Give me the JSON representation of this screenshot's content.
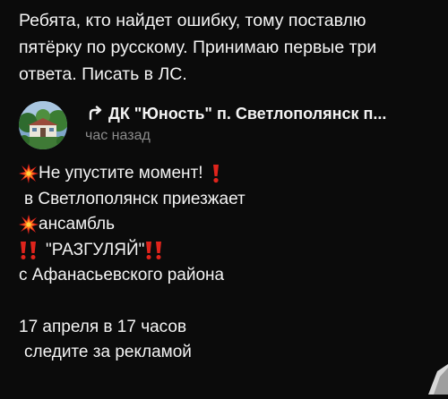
{
  "intro": {
    "lines": [
      "Ребята, кто найдет ошибку, тому поставлю",
      "пятёрку по русскому. Принимаю первые три",
      "ответа. Писать в ЛС."
    ]
  },
  "post": {
    "group_name": "ДК \"Юность\" п. Светлополянск п...",
    "time": "час назад",
    "body": {
      "line1": "Не упустите момент!",
      "line2": "в Светлополянск приезжает",
      "line3": "ансамбль",
      "line4": "\"РАЗГУЛЯЙ\"",
      "line5": "с Афанасьевского района",
      "line6": "17 апреля в 17 часов",
      "line7": "следите за рекламой"
    }
  },
  "icons": {
    "repost": "repost-arrow-icon",
    "spark": "collision-spark-emoji",
    "exclamation": "red-exclamation-emoji",
    "double_exclamation": "red-double-exclamation-emoji"
  },
  "colors": {
    "background": "#0b0b0b",
    "text": "#f4f4f4",
    "muted": "#8c8c8c",
    "emoji_red": "#e0241c",
    "emoji_orange": "#ff8a1e"
  }
}
